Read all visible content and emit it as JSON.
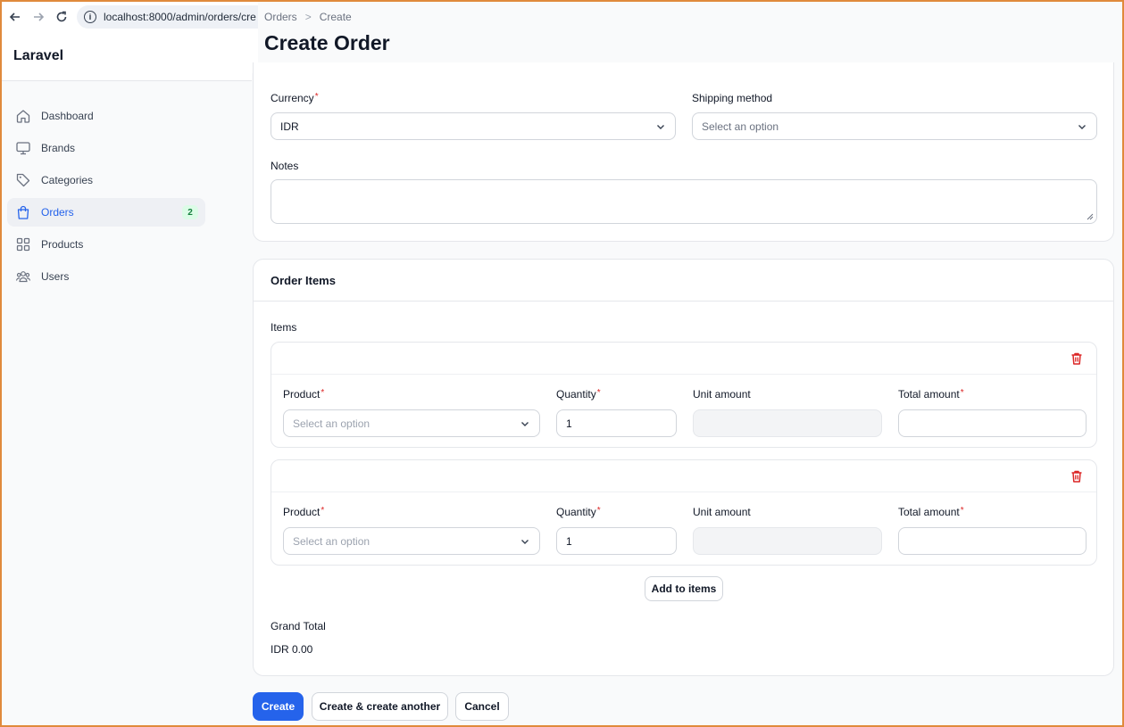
{
  "browser": {
    "url": "localhost:8000/admin/orders/cre",
    "icons": [
      "back-icon",
      "forward-icon",
      "reload-icon",
      "info-icon"
    ]
  },
  "app": {
    "brand": "Laravel"
  },
  "sidebar": {
    "items": [
      {
        "label": "Dashboard",
        "icon": "home-icon"
      },
      {
        "label": "Brands",
        "icon": "monitor-icon"
      },
      {
        "label": "Categories",
        "icon": "tag-icon"
      },
      {
        "label": "Orders",
        "icon": "shopping-bag-icon",
        "badge": "2",
        "active": true
      },
      {
        "label": "Products",
        "icon": "grid-icon"
      },
      {
        "label": "Users",
        "icon": "users-icon"
      }
    ]
  },
  "header": {
    "breadcrumb": [
      "Orders",
      "Create"
    ],
    "breadcrumb_separator": ">",
    "title": "Create Order"
  },
  "form": {
    "currency": {
      "label": "Currency",
      "value": "IDR"
    },
    "shipping_method": {
      "label": "Shipping method",
      "placeholder": "Select an option"
    },
    "notes": {
      "label": "Notes",
      "value": ""
    }
  },
  "order_items": {
    "section_title": "Order Items",
    "items_label": "Items",
    "rows": [
      {
        "product_label": "Product",
        "product_placeholder": "Select an option",
        "quantity_label": "Quantity",
        "quantity_value": "1",
        "unit_amount_label": "Unit amount",
        "total_amount_label": "Total amount"
      },
      {
        "product_label": "Product",
        "product_placeholder": "Select an option",
        "quantity_label": "Quantity",
        "quantity_value": "1",
        "unit_amount_label": "Unit amount",
        "total_amount_label": "Total amount"
      }
    ],
    "add_button": "Add to items",
    "grand_total_label": "Grand Total",
    "grand_total_value": "IDR 0.00"
  },
  "actions": {
    "create": "Create",
    "create_another": "Create & create another",
    "cancel": "Cancel"
  },
  "colors": {
    "primary": "#2563eb",
    "required": "#dc2626",
    "badge_bg": "#dcfce7",
    "badge_text": "#15803d",
    "delete": "#dc2626"
  }
}
